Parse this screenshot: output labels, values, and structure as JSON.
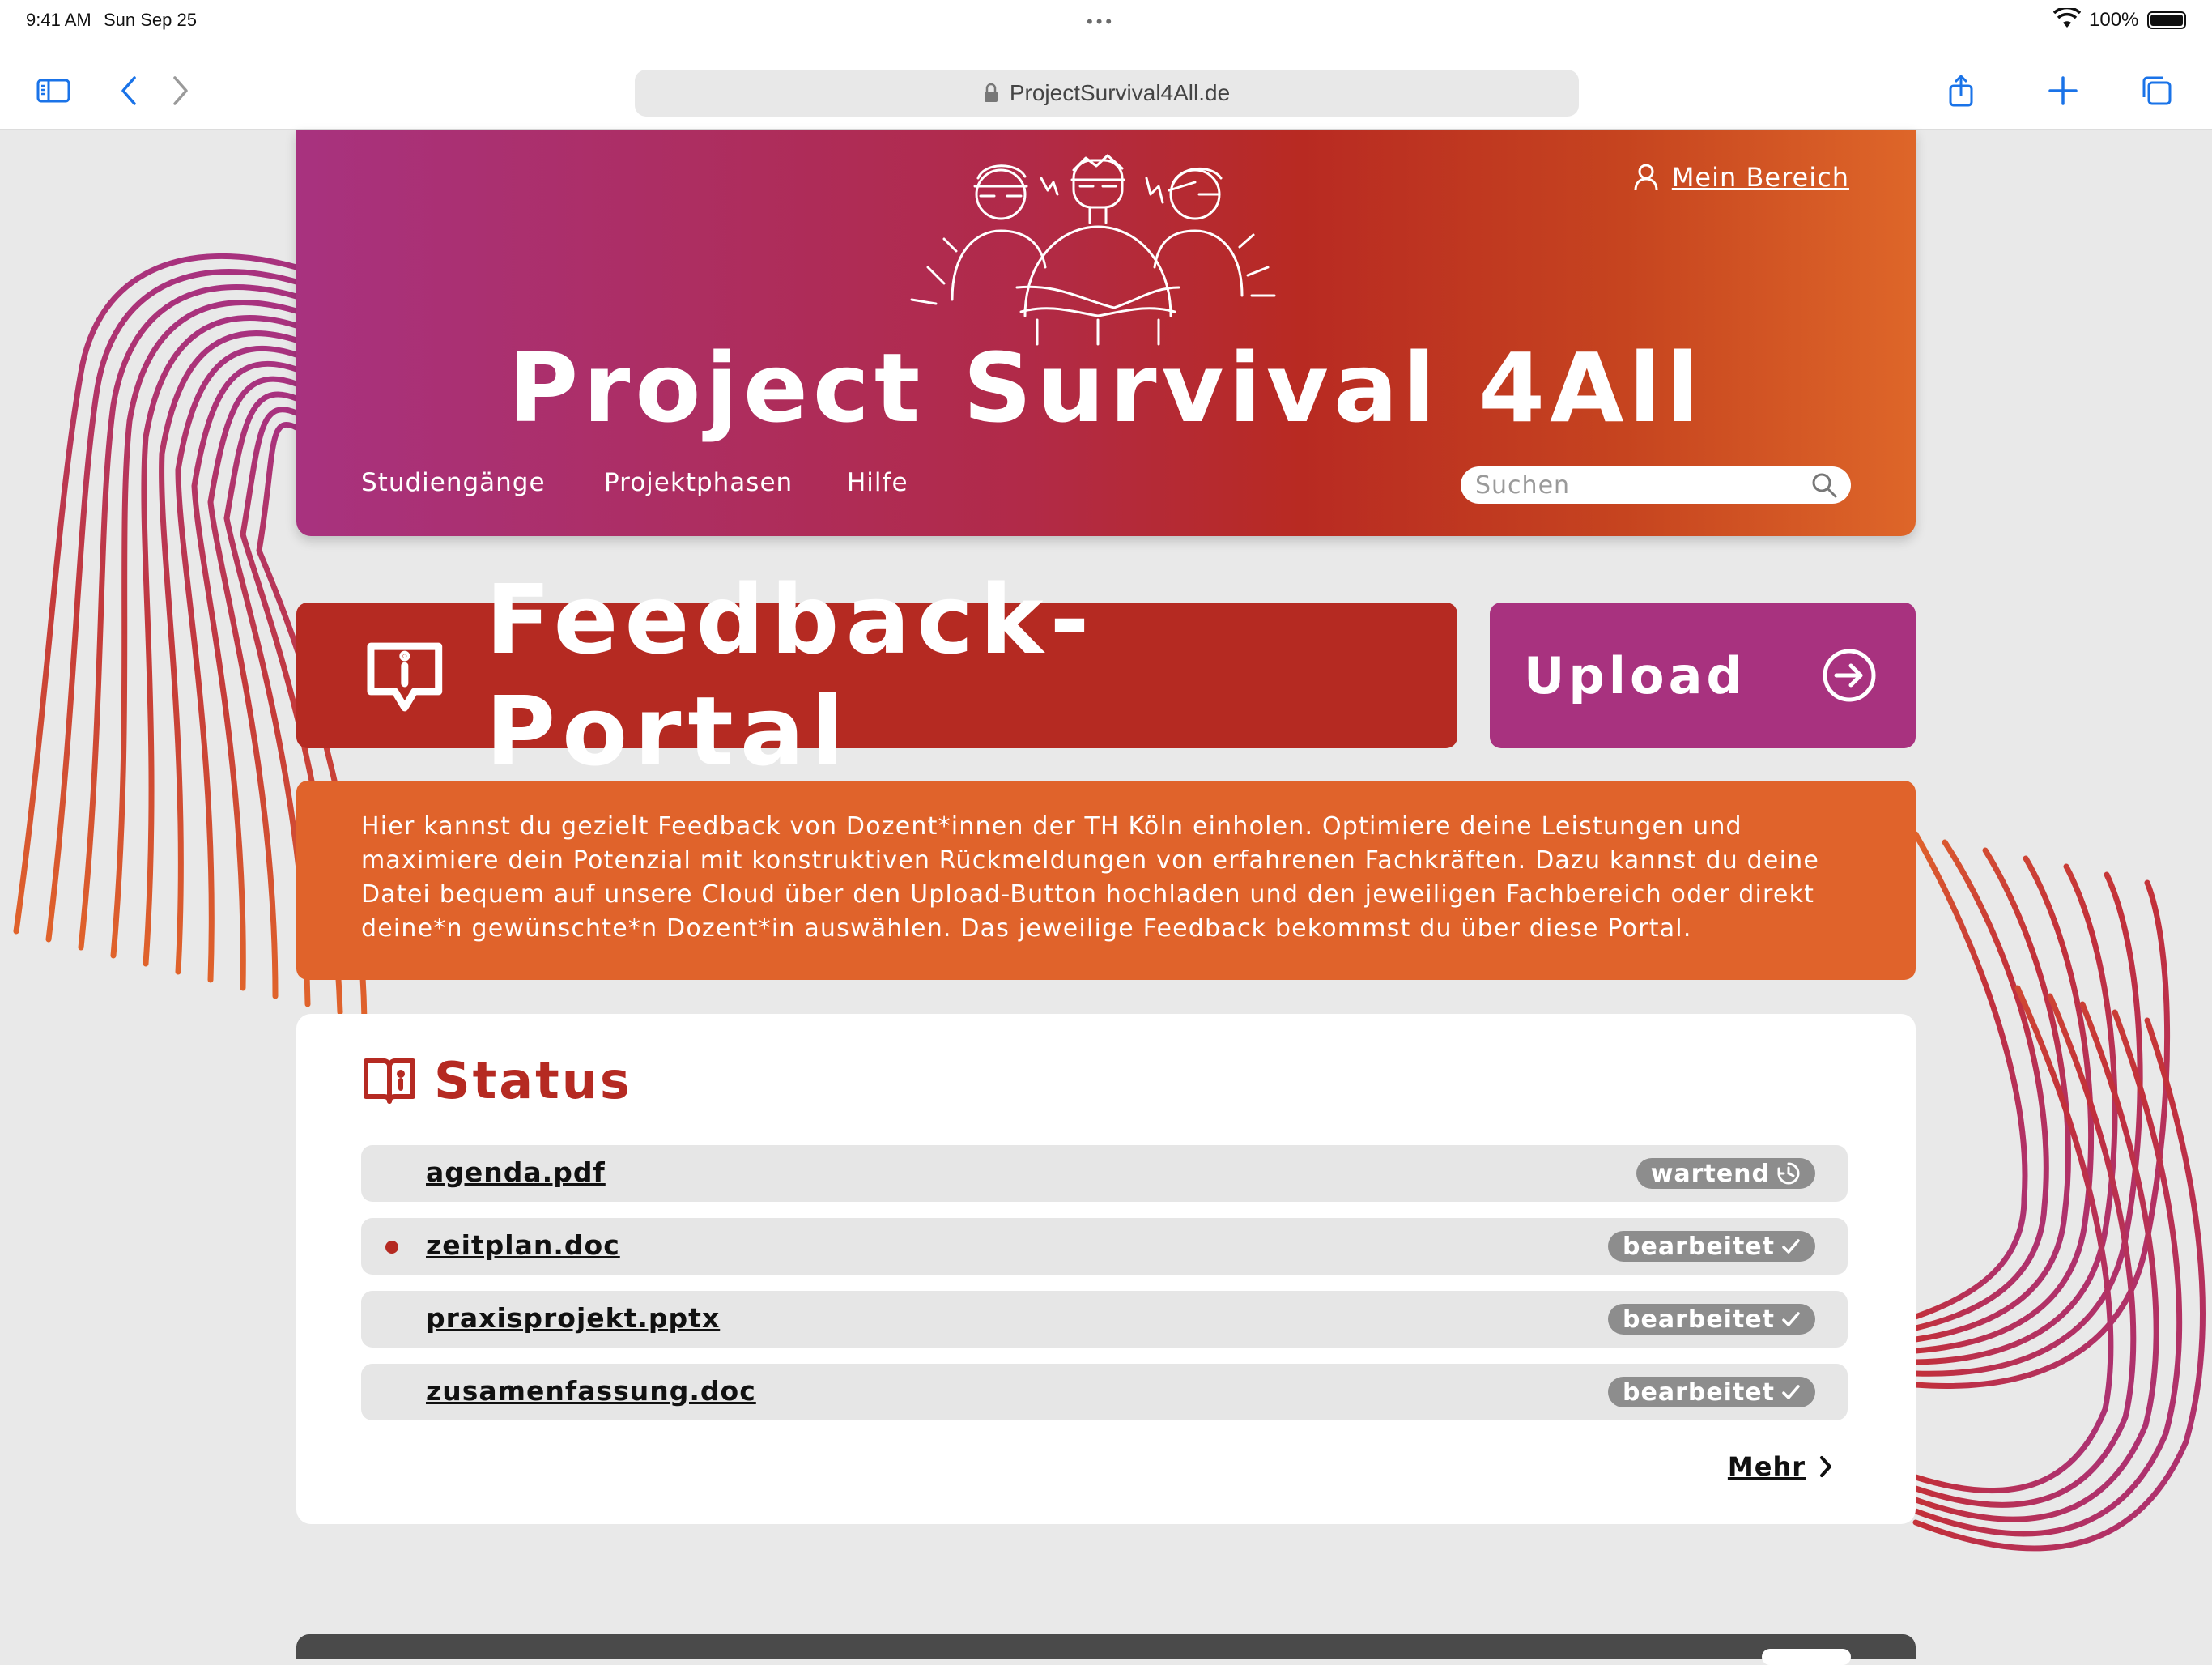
{
  "status_bar": {
    "time": "9:41 AM",
    "date": "Sun Sep 25",
    "battery": "100%"
  },
  "browser": {
    "url": "ProjectSurvival4All.de",
    "icons": [
      "sidebar-icon",
      "back-icon",
      "forward-icon",
      "lock-icon",
      "share-icon",
      "plus-icon",
      "tabs-icon"
    ]
  },
  "header": {
    "title": "Project Survival 4All",
    "account_link": "Mein Bereich",
    "nav": [
      "Studiengänge",
      "Projektphasen",
      "Hilfe"
    ],
    "search_placeholder": "Suchen"
  },
  "portal": {
    "title": "Feedback-Portal",
    "upload_label": "Upload"
  },
  "intro": {
    "text": "Hier kannst du gezielt Feedback von Dozent*innen der TH Köln einholen. Optimiere deine Leistungen und maximiere dein Potenzial mit konstruktiven Rückmeldungen von erfahrenen Fachkräften. Dazu kannst du deine Datei bequem auf unsere Cloud über den Upload-Button hochladen und den jeweiligen Fachbereich oder direkt deine*n gewünschte*n Dozent*in auswählen. Das jeweilige Feedback bekommst du über diese Portal."
  },
  "status": {
    "title": "Status",
    "files": [
      {
        "name": "agenda.pdf",
        "state": "wartend",
        "icon": "clock-icon",
        "unread": false
      },
      {
        "name": "zeitplan.doc",
        "state": "bearbeitet",
        "icon": "check-icon",
        "unread": true
      },
      {
        "name": "praxisprojekt.pptx",
        "state": "bearbeitet",
        "icon": "check-icon",
        "unread": false
      },
      {
        "name": "zusamenfassung.doc",
        "state": "bearbeitet",
        "icon": "check-icon",
        "unread": false
      }
    ],
    "more_label": "Mehr"
  },
  "colors": {
    "magenta": "#a8327f",
    "red": "#b52a22",
    "orange": "#e0632b",
    "badge_gray": "#8d8d8d",
    "page_bg": "#e9e9e9",
    "safari_blue": "#1a73e8"
  }
}
